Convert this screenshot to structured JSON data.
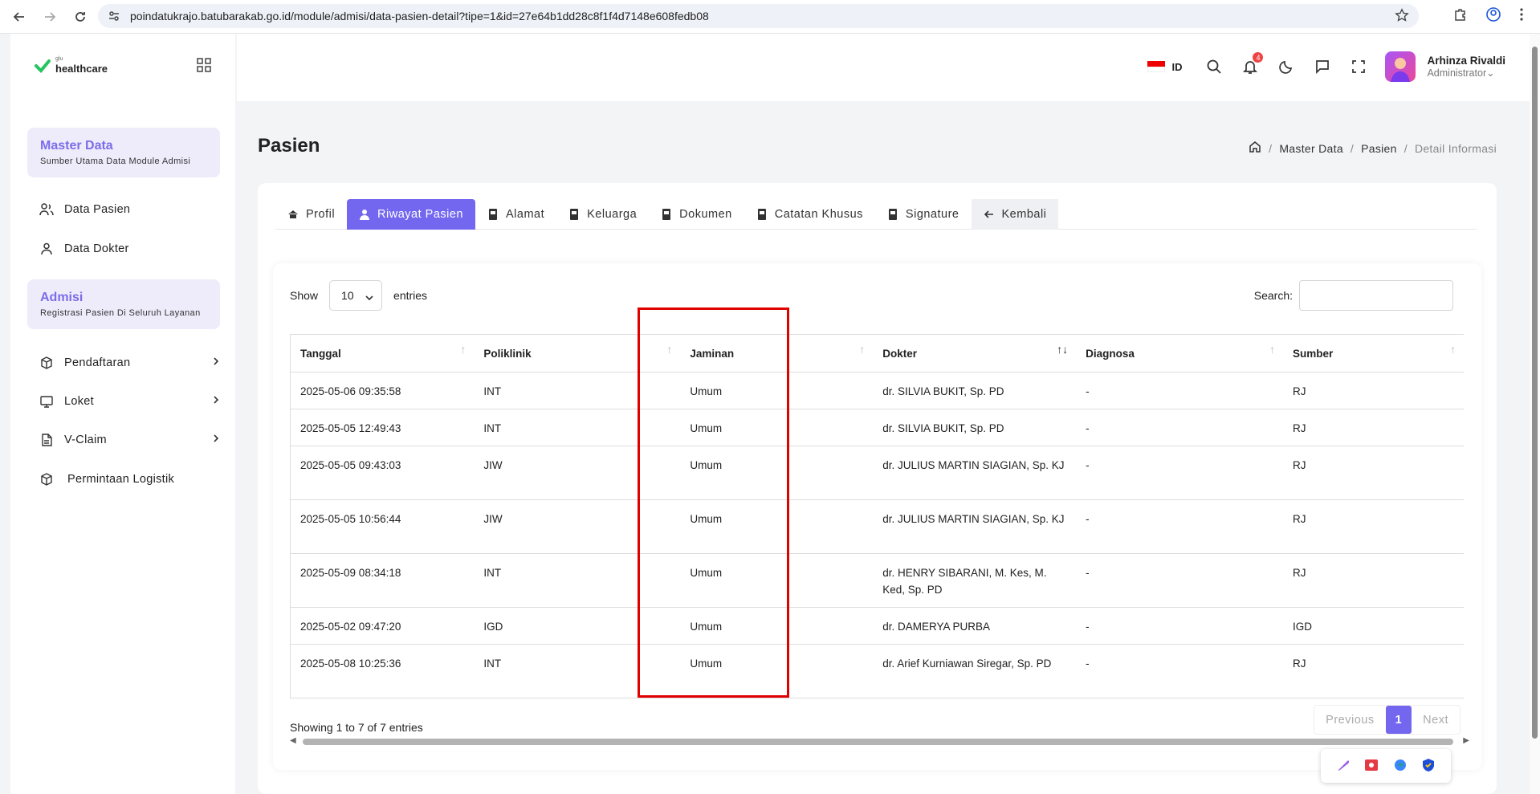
{
  "browser": {
    "url": "poindatukrajo.batubarakab.go.id/module/admisi/data-pasien-detail?tipe=1&id=27e64b1dd28c8f1f4d7148e608fedb08"
  },
  "sidebar": {
    "logo_top": "glu",
    "logo_name": "healthcare",
    "cards": [
      {
        "title": "Master Data",
        "subtitle": "Sumber Utama Data Module Admisi"
      },
      {
        "title": "Admisi",
        "subtitle": "Registrasi Pasien Di Seluruh Layanan"
      }
    ],
    "items": [
      {
        "label": "Data Pasien",
        "icon": "users-icon"
      },
      {
        "label": "Data Dokter",
        "icon": "user-icon"
      },
      {
        "label": "Pendaftaran",
        "icon": "box-icon"
      },
      {
        "label": "Loket",
        "icon": "monitor-icon"
      },
      {
        "label": "V-Claim",
        "icon": "file-icon"
      },
      {
        "label": "Permintaan Logistik",
        "icon": "box-icon"
      }
    ]
  },
  "header": {
    "lang": "ID",
    "notif_count": "4",
    "user_name": "Arhinza Rivaldi",
    "user_role": "Administrator"
  },
  "page": {
    "title": "Pasien",
    "breadcrumb": [
      "Master Data",
      "Pasien",
      "Detail Informasi"
    ]
  },
  "tabs": [
    {
      "label": "Profil"
    },
    {
      "label": "Riwayat Pasien"
    },
    {
      "label": "Alamat"
    },
    {
      "label": "Keluarga"
    },
    {
      "label": "Dokumen"
    },
    {
      "label": "Catatan Khusus"
    },
    {
      "label": "Signature"
    },
    {
      "label": "Kembali"
    }
  ],
  "table_controls": {
    "show_label": "Show",
    "entries_value": "10",
    "entries_label": "entries",
    "search_label": "Search:"
  },
  "table": {
    "headers": [
      "Tanggal",
      "Poliklinik",
      "Jaminan",
      "Dokter",
      "Diagnosa",
      "Sumber"
    ],
    "rows": [
      [
        "2025-05-06 09:35:58",
        "INT",
        "Umum",
        "dr. SILVIA BUKIT, Sp. PD",
        "-",
        "RJ"
      ],
      [
        "2025-05-05 12:49:43",
        "INT",
        "Umum",
        "dr. SILVIA BUKIT, Sp. PD",
        "-",
        "RJ"
      ],
      [
        "2025-05-05 09:43:03",
        "JIW",
        "Umum",
        "dr. JULIUS MARTIN SIAGIAN, Sp. KJ",
        "-",
        "RJ"
      ],
      [
        "2025-05-05 10:56:44",
        "JIW",
        "Umum",
        "dr. JULIUS MARTIN SIAGIAN, Sp. KJ",
        "-",
        "RJ"
      ],
      [
        "2025-05-09 08:34:18",
        "INT",
        "Umum",
        "dr. HENRY SIBARANI, M. Kes, M. Ked, Sp. PD",
        "-",
        "RJ"
      ],
      [
        "2025-05-02 09:47:20",
        "IGD",
        "Umum",
        "dr. DAMERYA PURBA",
        "-",
        "IGD"
      ],
      [
        "2025-05-08 10:25:36",
        "INT",
        "Umum",
        "dr. Arief Kurniawan Siregar, Sp. PD",
        "-",
        "RJ"
      ]
    ]
  },
  "footer": {
    "showing": "Showing 1 to 7 of 7 entries",
    "prev": "Previous",
    "page": "1",
    "next": "Next"
  }
}
